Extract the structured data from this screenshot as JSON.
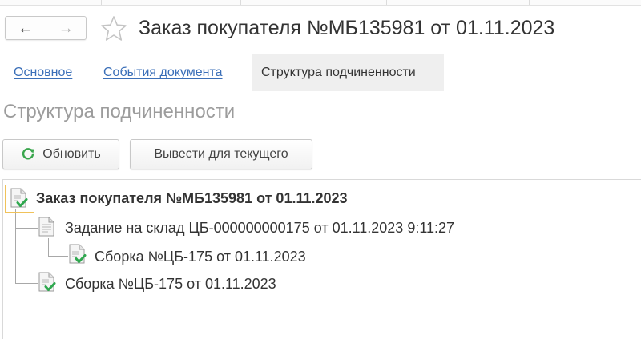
{
  "header": {
    "back_icon": "arrow-left-icon",
    "forward_icon": "arrow-right-icon",
    "favorite_icon": "star-outline-icon",
    "title": "Заказ покупателя №МБ135981 от 01.11.2023"
  },
  "tabs": [
    {
      "label": "Основное",
      "state": "link"
    },
    {
      "label": "События документа",
      "state": "link"
    },
    {
      "label": "Структура подчиненности",
      "state": "active"
    }
  ],
  "section_title": "Структура подчиненности",
  "toolbar": {
    "refresh_label": "Обновить",
    "refresh_icon": "refresh-icon",
    "show_current_label": "Вывести для текущего"
  },
  "tree": {
    "nodes": [
      {
        "label": "Заказ покупателя №МБ135981 от 01.11.2023",
        "icon": "document-posted-icon",
        "level": 0,
        "current": true
      },
      {
        "label": "Задание на склад ЦБ-000000000175 от 01.11.2023 9:11:27",
        "icon": "document-icon",
        "level": 1,
        "current": false
      },
      {
        "label": "Сборка №ЦБ-175 от 01.11.2023",
        "icon": "document-posted-icon",
        "level": 2,
        "current": false
      },
      {
        "label": "Сборка №ЦБ-175 от 01.11.2023",
        "icon": "document-posted-icon",
        "level": 1,
        "current": false
      }
    ]
  },
  "colors": {
    "link": "#3b6fb8",
    "active_tab_bg": "#efefef",
    "section_title": "#9c9c9c",
    "posted_check": "#2fa84f",
    "focus_frame": "#f0c25a",
    "refresh_icon": "#3aa64d"
  }
}
